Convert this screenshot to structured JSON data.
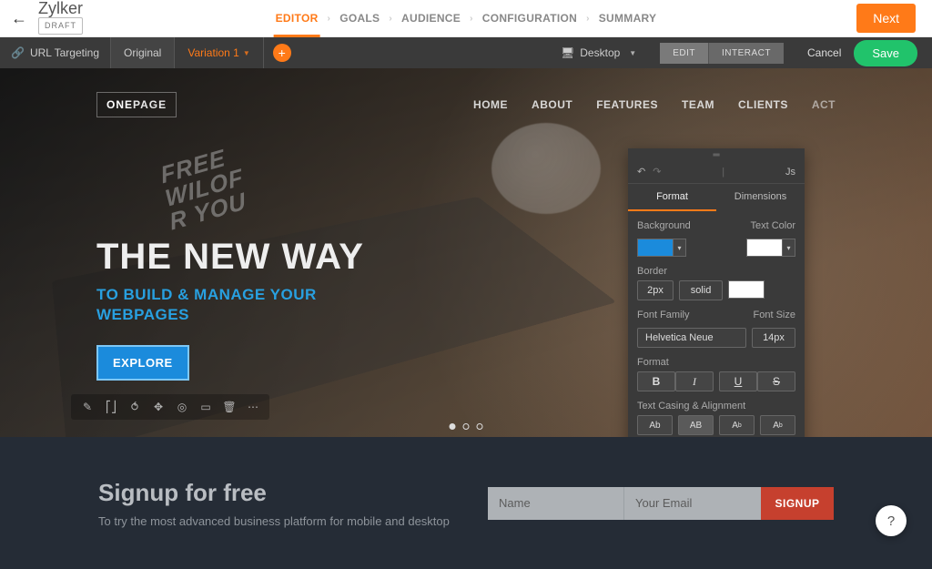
{
  "header": {
    "project_name": "Zylker",
    "status_badge": "DRAFT",
    "breadcrumbs": [
      "EDITOR",
      "GOALS",
      "AUDIENCE",
      "CONFIGURATION",
      "SUMMARY"
    ],
    "active_breadcrumb_index": 0,
    "next_label": "Next"
  },
  "toolbar": {
    "url_targeting": "URL Targeting",
    "original_tab": "Original",
    "variation_tab": "Variation 1",
    "device": "Desktop",
    "edit_mode": "EDIT",
    "interact_mode": "INTERACT",
    "cancel": "Cancel",
    "save": "Save"
  },
  "canvas_site": {
    "logo_prefix": "ONE",
    "logo_suffix": "PAGE",
    "nav": [
      "HOME",
      "ABOUT",
      "FEATURES",
      "TEAM",
      "CLIENTS",
      "ACT"
    ],
    "screen_text": [
      "FREE",
      "WILOF",
      "R YOU"
    ],
    "hero_h1": "THE NEW WAY",
    "hero_h2_line1": "TO BUILD & MANAGE YOUR",
    "hero_h2_line2": "WEBPAGES",
    "explore_btn": "EXPLORE"
  },
  "format_panel": {
    "js_label": "Js",
    "tab_format": "Format",
    "tab_dimensions": "Dimensions",
    "background_label": "Background",
    "textcolor_label": "Text Color",
    "background_color": "#1b8bdc",
    "text_color": "#ffffff",
    "border_label": "Border",
    "border_width": "2px",
    "border_style": "solid",
    "border_color": "#ffffff",
    "font_family_label": "Font Family",
    "font_family": "Helvetica Neue",
    "font_size_label": "Font Size",
    "font_size": "14px",
    "format_label": "Format",
    "casing_label": "Text Casing & Alignment",
    "dom_path": [
      "body",
      "section",
      "div",
      "div",
      "div",
      "div",
      "a"
    ]
  },
  "signup": {
    "title": "Signup for free",
    "subtitle": "To try the most advanced business platform for mobile and desktop",
    "name_placeholder": "Name",
    "email_placeholder": "Your Email",
    "button": "SIGNUP"
  },
  "help_fab": "?"
}
